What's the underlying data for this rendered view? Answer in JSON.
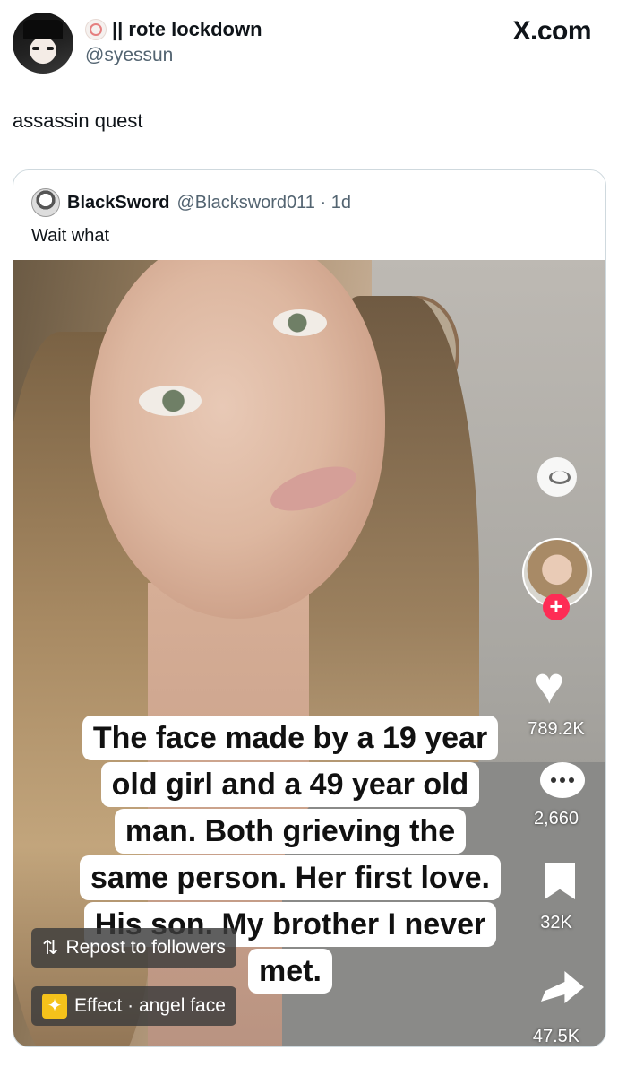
{
  "header": {
    "display_name": "|| rote lockdown",
    "handle": "@syessun",
    "source": "X.com"
  },
  "tweet": {
    "text": "assassin quest"
  },
  "quoted_tweet": {
    "author_name": "BlackSword",
    "handle": "@Blacksword011 · 1d",
    "text": "Wait what",
    "media": {
      "caption_lines": [
        "The face made by a 19 year",
        "old girl and a 49 year old",
        "man. Both grieving the",
        "same person. Her first love.",
        "His son. My brother I never",
        "met."
      ],
      "likes": "789.2K",
      "comments": "2,660",
      "bookmarks": "32K",
      "shares": "47.5K",
      "repost_label": "Repost to followers",
      "effect_label": "Effect · angel face"
    }
  }
}
